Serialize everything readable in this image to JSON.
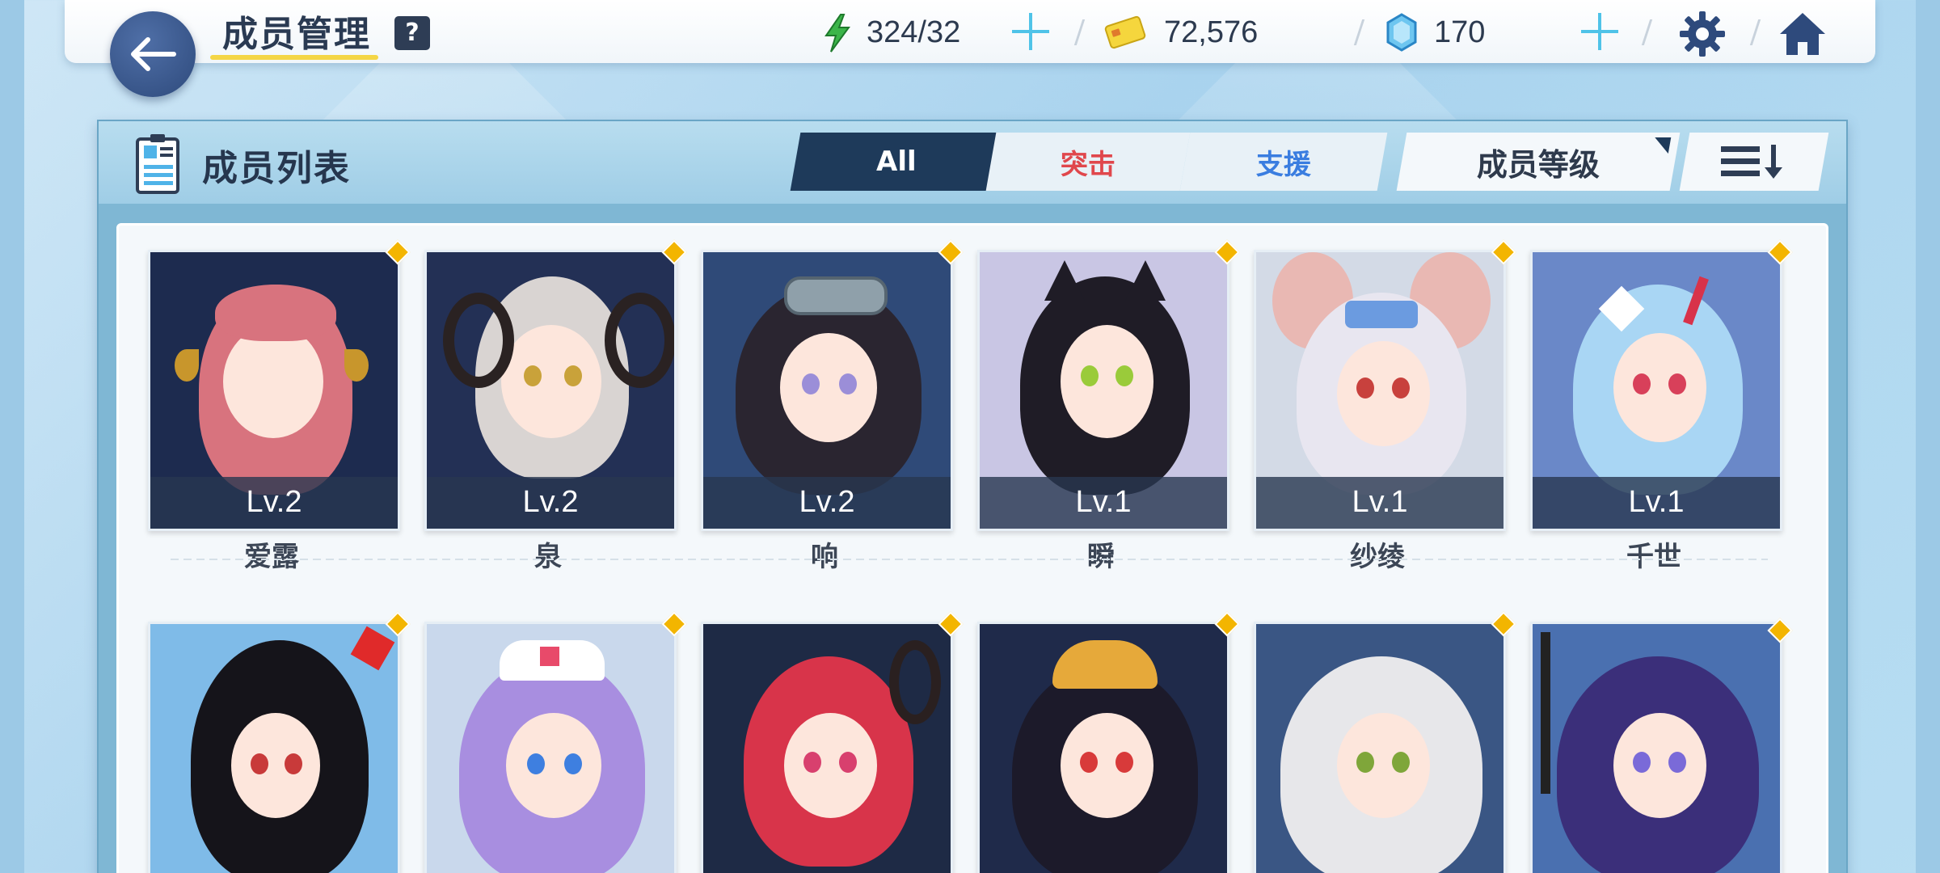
{
  "header": {
    "title": "成员管理",
    "help_label": "?",
    "stamina": "324/32",
    "credits": "72,576",
    "gems": "170"
  },
  "panel": {
    "title": "成员列表",
    "tabs": [
      {
        "label": "All",
        "active": true
      },
      {
        "label": "突击",
        "color": "#e0474c"
      },
      {
        "label": "支援",
        "color": "#3a7de0"
      }
    ],
    "sort_label": "成员等级"
  },
  "members_row1": [
    {
      "level": "Lv.2",
      "name": "爱露"
    },
    {
      "level": "Lv.2",
      "name": "泉"
    },
    {
      "level": "Lv.2",
      "name": "响"
    },
    {
      "level": "Lv.1",
      "name": "瞬"
    },
    {
      "level": "Lv.1",
      "name": "纱绫"
    },
    {
      "level": "Lv.1",
      "name": "千世"
    }
  ],
  "members_row2_count": 6,
  "colors": {
    "accent_dark": "#1e3a5a",
    "title_underline": "#f4d646",
    "plus": "#4fc3e8",
    "badge_diamond": "#f3b500"
  },
  "icons": [
    "back-arrow-icon",
    "help-icon",
    "lightning-icon",
    "credit-card-icon",
    "gem-icon",
    "gear-icon",
    "home-icon",
    "member-list-icon",
    "sort-descending-icon"
  ]
}
